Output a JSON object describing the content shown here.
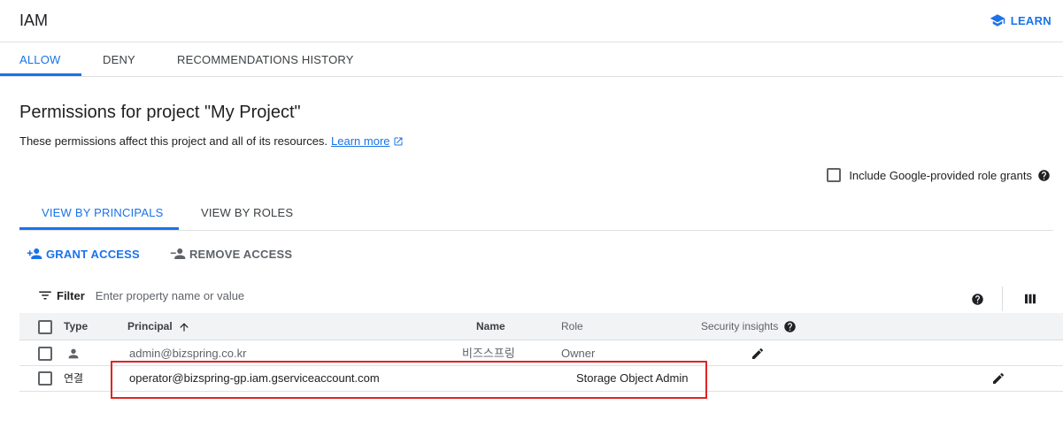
{
  "app": {
    "title": "IAM",
    "learn_label": "LEARN"
  },
  "main_tabs": [
    {
      "label": "ALLOW",
      "active": true
    },
    {
      "label": "DENY",
      "active": false
    },
    {
      "label": "RECOMMENDATIONS HISTORY",
      "active": false
    }
  ],
  "page": {
    "heading": "Permissions for project \"My Project\"",
    "description": "These permissions affect this project and all of its resources.",
    "learn_more": "Learn more",
    "include_google_label": "Include Google-provided role grants"
  },
  "view_tabs": [
    {
      "label": "VIEW BY PRINCIPALS",
      "active": true
    },
    {
      "label": "VIEW BY ROLES",
      "active": false
    }
  ],
  "actions": {
    "grant": "GRANT ACCESS",
    "remove": "REMOVE ACCESS"
  },
  "filter": {
    "label": "Filter",
    "placeholder": "Enter property name or value"
  },
  "table": {
    "columns": {
      "type": "Type",
      "principal": "Principal",
      "name": "Name",
      "role": "Role",
      "insights": "Security insights"
    },
    "rows": [
      {
        "type_icon": "person-icon",
        "principal": "admin@bizspring.co.kr",
        "name": "비즈스프링",
        "role": "Owner"
      },
      {
        "type_label": "연결",
        "principal": "operator@bizspring-gp.iam.gserviceaccount.com",
        "name": "",
        "role": "Storage Object Admin"
      }
    ]
  },
  "colors": {
    "accent": "#1a73e8",
    "highlight": "#e02424"
  }
}
